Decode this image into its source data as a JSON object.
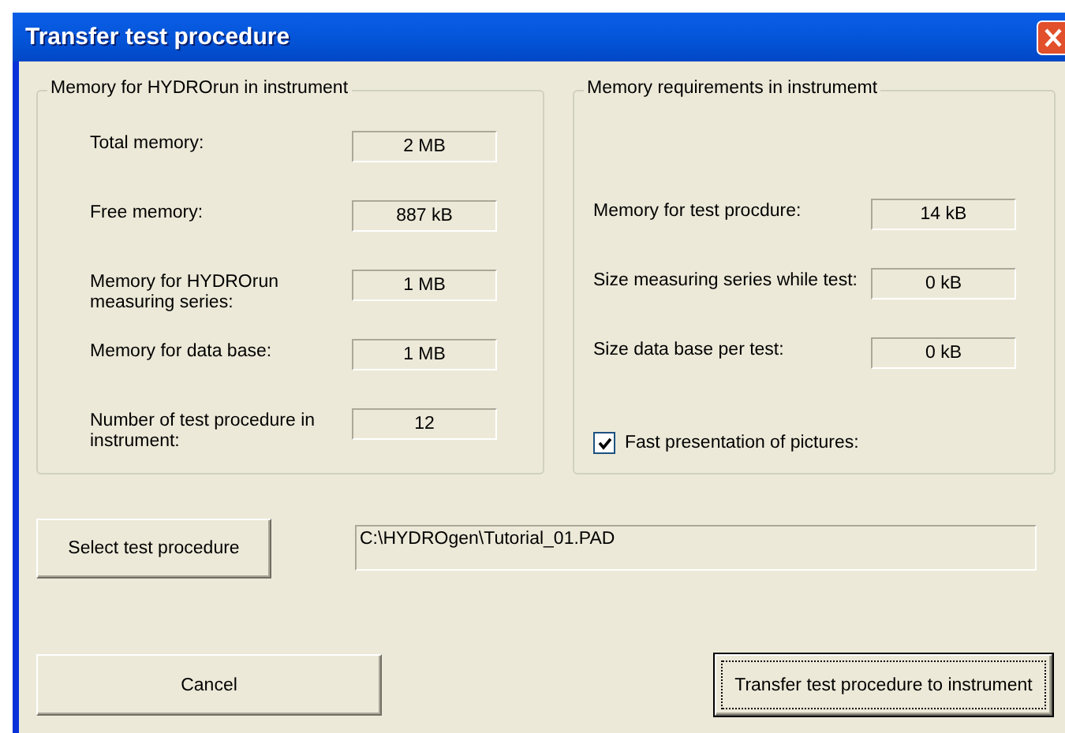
{
  "window": {
    "title": "Transfer test procedure"
  },
  "memory_group": {
    "title": "Memory for HYDROrun in instrument",
    "rows": [
      {
        "label": "Total memory:",
        "value": "2 MB"
      },
      {
        "label": "Free memory:",
        "value": "887 kB"
      },
      {
        "label": "Memory for HYDROrun measuring series:",
        "value": "1 MB"
      },
      {
        "label": "Memory for data base:",
        "value": "1 MB"
      },
      {
        "label": "Number of test procedure in instrument:",
        "value": "12"
      }
    ]
  },
  "requirements_group": {
    "title": "Memory requirements in instrumemt",
    "rows": [
      {
        "label": "Memory for test procdure:",
        "value": "14 kB"
      },
      {
        "label": "Size measuring series while test:",
        "value": "0 kB"
      },
      {
        "label": "Size data base per test:",
        "value": "0 kB"
      }
    ],
    "checkbox": {
      "label": "Fast presentation of pictures:",
      "checked": true
    }
  },
  "select_button": {
    "label": "Select test procedure"
  },
  "path_field": {
    "value": "C:\\HYDROgen\\Tutorial_01.PAD"
  },
  "buttons": [
    {
      "label": "Cancel",
      "default": false
    },
    {
      "label": "Transfer test procedure to instrument",
      "default": true
    }
  ]
}
